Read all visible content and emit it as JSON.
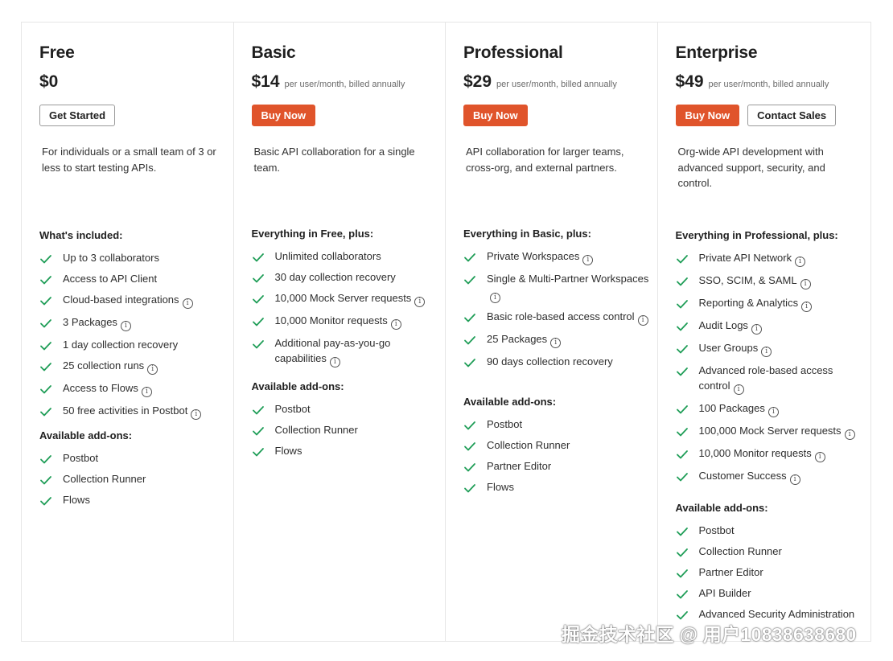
{
  "plans": [
    {
      "name": "Free",
      "price": "$0",
      "price_note": "",
      "buttons": [
        {
          "label": "Get Started",
          "style": "outline"
        }
      ],
      "description": "For individuals or a small team of 3 or less to start testing APIs.",
      "included_title": "What's included:",
      "features": [
        {
          "text": "Up to 3 collaborators",
          "info": false
        },
        {
          "text": "Access to API Client",
          "info": false
        },
        {
          "text": "Cloud-based integrations",
          "info": true
        },
        {
          "text": "3 Packages",
          "info": true
        },
        {
          "text": "1 day collection recovery",
          "info": false
        },
        {
          "text": "25 collection runs",
          "info": true
        },
        {
          "text": "Access to Flows",
          "info": true
        },
        {
          "text": "50 free activities in Postbot",
          "info": true
        }
      ],
      "addons_title": "Available add-ons:",
      "addons": [
        "Postbot",
        "Collection Runner",
        "Flows"
      ]
    },
    {
      "name": "Basic",
      "price": "$14",
      "price_note": "per user/month, billed annually",
      "buttons": [
        {
          "label": "Buy Now",
          "style": "primary"
        }
      ],
      "description": "Basic API collaboration for a single team.",
      "included_title": "Everything in Free, plus:",
      "features": [
        {
          "text": "Unlimited collaborators",
          "info": false
        },
        {
          "text": "30 day collection recovery",
          "info": false
        },
        {
          "text": "10,000 Mock Server requests",
          "info": true
        },
        {
          "text": "10,000 Monitor requests",
          "info": true
        },
        {
          "text": "Additional pay-as-you-go capabilities",
          "info": true
        }
      ],
      "addons_title": "Available add-ons:",
      "addons": [
        "Postbot",
        "Collection Runner",
        "Flows"
      ]
    },
    {
      "name": "Professional",
      "price": "$29",
      "price_note": "per user/month, billed annually",
      "buttons": [
        {
          "label": "Buy Now",
          "style": "primary"
        }
      ],
      "description": "API collaboration for larger teams, cross-org, and external partners.",
      "included_title": "Everything in Basic, plus:",
      "features": [
        {
          "text": "Private Workspaces",
          "info": true
        },
        {
          "text": "Single & Multi-Partner Workspaces",
          "info": true
        },
        {
          "text": "Basic role-based access control",
          "info": true
        },
        {
          "text": "25 Packages",
          "info": true
        },
        {
          "text": "90 days collection recovery",
          "info": false
        }
      ],
      "addons_title": "Available add-ons:",
      "addons": [
        "Postbot",
        "Collection Runner",
        "Partner Editor",
        "Flows"
      ]
    },
    {
      "name": "Enterprise",
      "price": "$49",
      "price_note": "per user/month, billed annually",
      "buttons": [
        {
          "label": "Buy Now",
          "style": "primary"
        },
        {
          "label": "Contact Sales",
          "style": "outline"
        }
      ],
      "description": "Org-wide API development with advanced support, security, and control.",
      "included_title": "Everything in Professional, plus:",
      "features": [
        {
          "text": "Private API Network",
          "info": true
        },
        {
          "text": "SSO, SCIM, & SAML",
          "info": true
        },
        {
          "text": "Reporting & Analytics",
          "info": true
        },
        {
          "text": "Audit Logs",
          "info": true
        },
        {
          "text": "User Groups",
          "info": true
        },
        {
          "text": "Advanced role-based access control",
          "info": true
        },
        {
          "text": "100 Packages",
          "info": true
        },
        {
          "text": "100,000 Mock Server requests",
          "info": true
        },
        {
          "text": "10,000 Monitor requests",
          "info": true
        },
        {
          "text": "Customer Success",
          "info": true
        }
      ],
      "addons_title": "Available add-ons:",
      "addons": [
        "Postbot",
        "Collection Runner",
        "Partner Editor",
        "API Builder",
        "Advanced Security Administration"
      ]
    }
  ],
  "watermark": "掘金技术社区 @ 用户10838638680",
  "colors": {
    "accent": "#e0542b",
    "check": "#1f9d57",
    "border": "#e6e6e6"
  },
  "icons": {
    "check": "check-icon",
    "info": "info-icon"
  }
}
